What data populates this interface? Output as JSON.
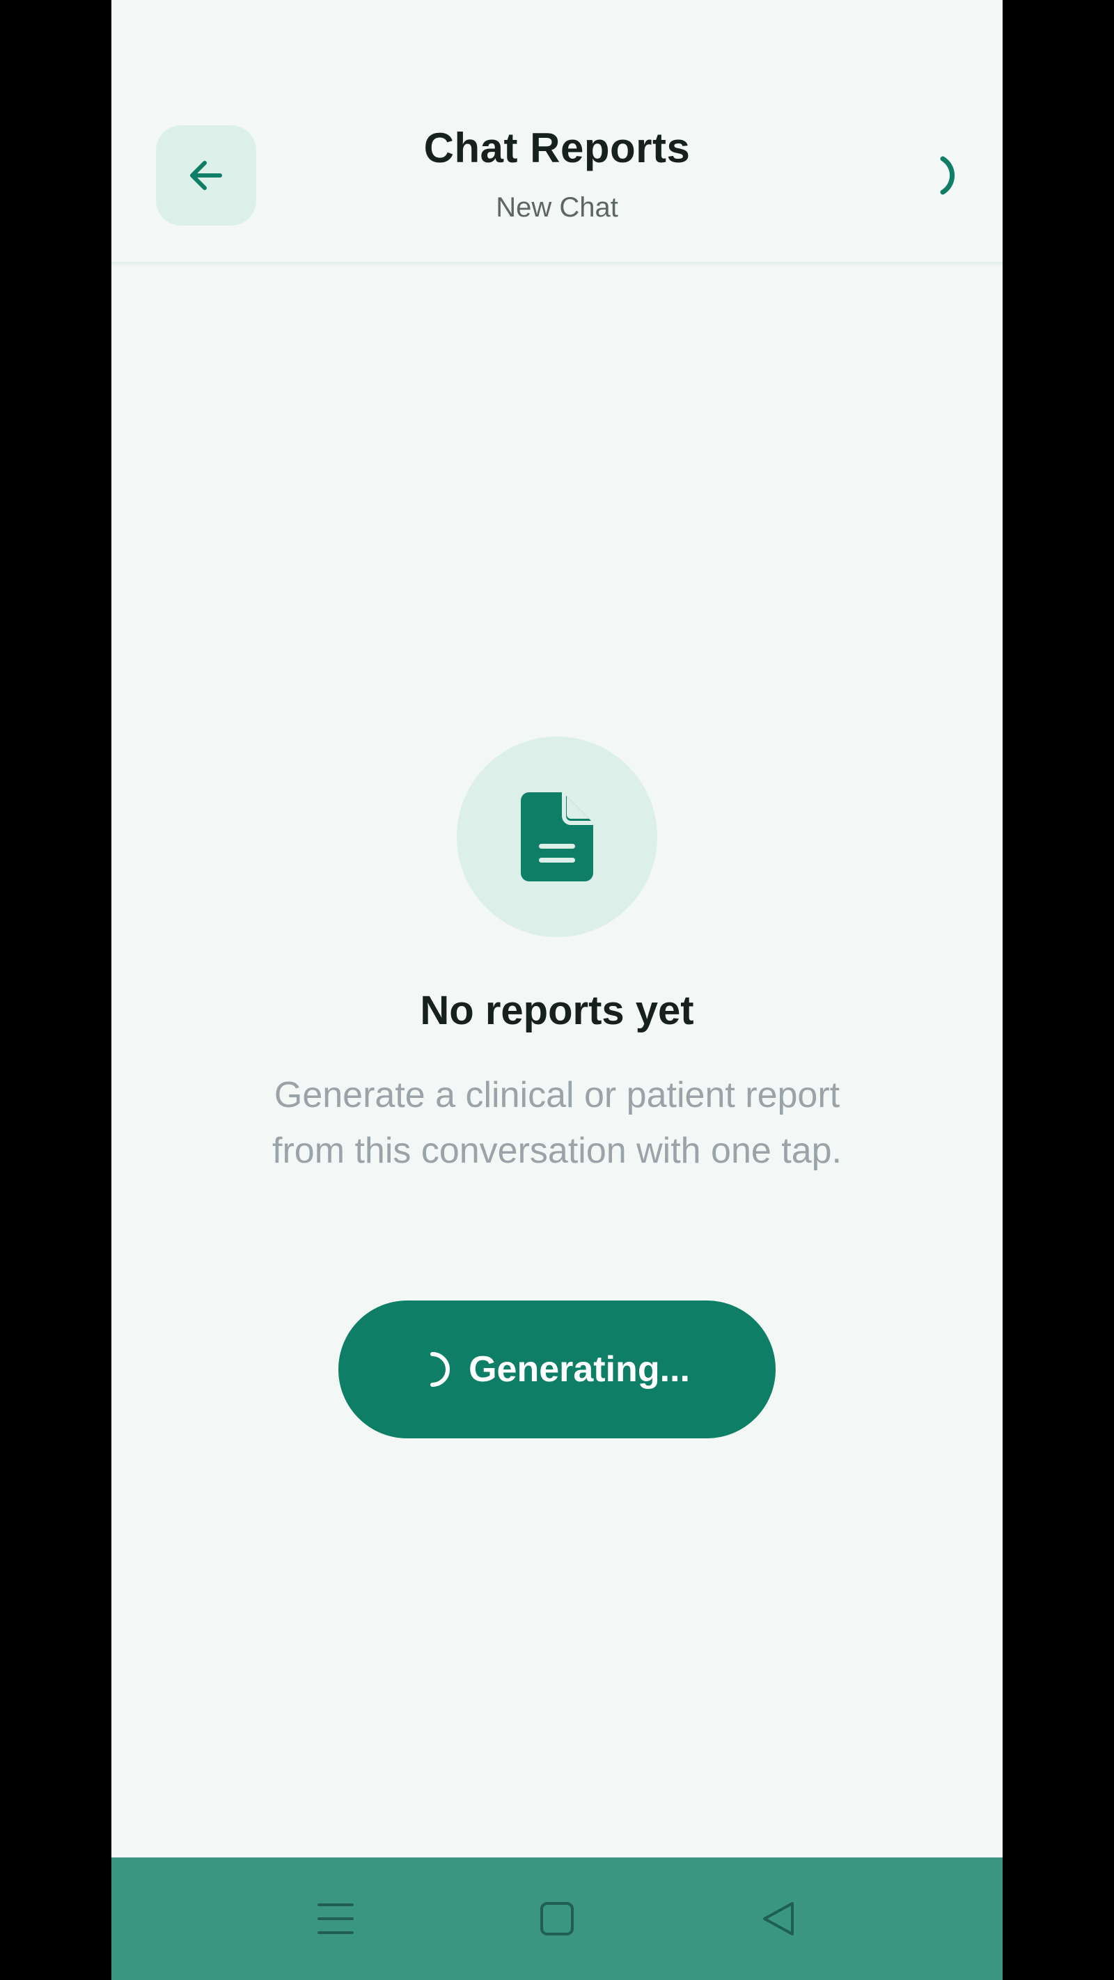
{
  "header": {
    "title": "Chat Reports",
    "subtitle": "New Chat"
  },
  "empty_state": {
    "title": "No reports yet",
    "description": "Generate a clinical or patient report from this conversation with one tap."
  },
  "generate_button": {
    "label": "Generating..."
  },
  "icons": {
    "back": "arrow-left-icon",
    "loading": "spinner-icon",
    "report": "document-icon",
    "recents": "menu-icon",
    "home": "square-icon",
    "back_nav": "triangle-left-icon"
  },
  "colors": {
    "accent": "#0e7e66",
    "accent_light": "#dcefe9",
    "background": "#f3f8f6",
    "nav_bar": "#3a9682"
  }
}
